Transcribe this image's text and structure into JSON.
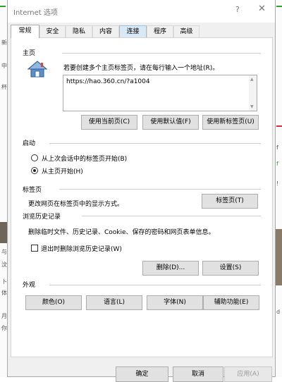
{
  "window": {
    "title": "Internet 选项",
    "help_glyph": "?",
    "close_glyph": "✕"
  },
  "tabs": [
    {
      "label": "常规",
      "active": true
    },
    {
      "label": "安全"
    },
    {
      "label": "隐私"
    },
    {
      "label": "内容"
    },
    {
      "label": "连接",
      "hover": true
    },
    {
      "label": "程序"
    },
    {
      "label": "高级"
    }
  ],
  "home": {
    "title": "主页",
    "description": "若要创建多个主页标签页，请在每行输入一个地址(R)。",
    "url": "https://hao.360.cn/?a1004",
    "buttons": [
      "使用当前页(C)",
      "使用默认值(F)",
      "使用新标签页(U)"
    ]
  },
  "startup": {
    "title": "启动",
    "options": [
      "从上次会话中的标签页开始(B)",
      "从主页开始(H)"
    ],
    "selected": 1
  },
  "tabs_section": {
    "title": "标签页",
    "description": "更改网页在标签页中的显示方式。",
    "button": "标签页(T)"
  },
  "history": {
    "title": "浏览历史记录",
    "description": "删除临时文件、历史记录、Cookie、保存的密码和网页表单信息。",
    "checkbox": "退出时删除浏览历史记录(W)",
    "checked": false,
    "buttons": [
      "删除(D)...",
      "设置(S)"
    ]
  },
  "appearance": {
    "title": "外观",
    "buttons": [
      "颜色(O)",
      "语言(L)",
      "字体(N)",
      "辅助功能(E)"
    ]
  },
  "footer": {
    "ok": "确定",
    "cancel": "取消",
    "apply": "应用(A)"
  },
  "background": {
    "left_marks": [
      "新",
      "中",
      "杯",
      "与",
      "汶",
      "卜",
      "体",
      "月",
      "你"
    ],
    "right_marks": [
      "f",
      "f",
      "!",
      "d"
    ]
  }
}
